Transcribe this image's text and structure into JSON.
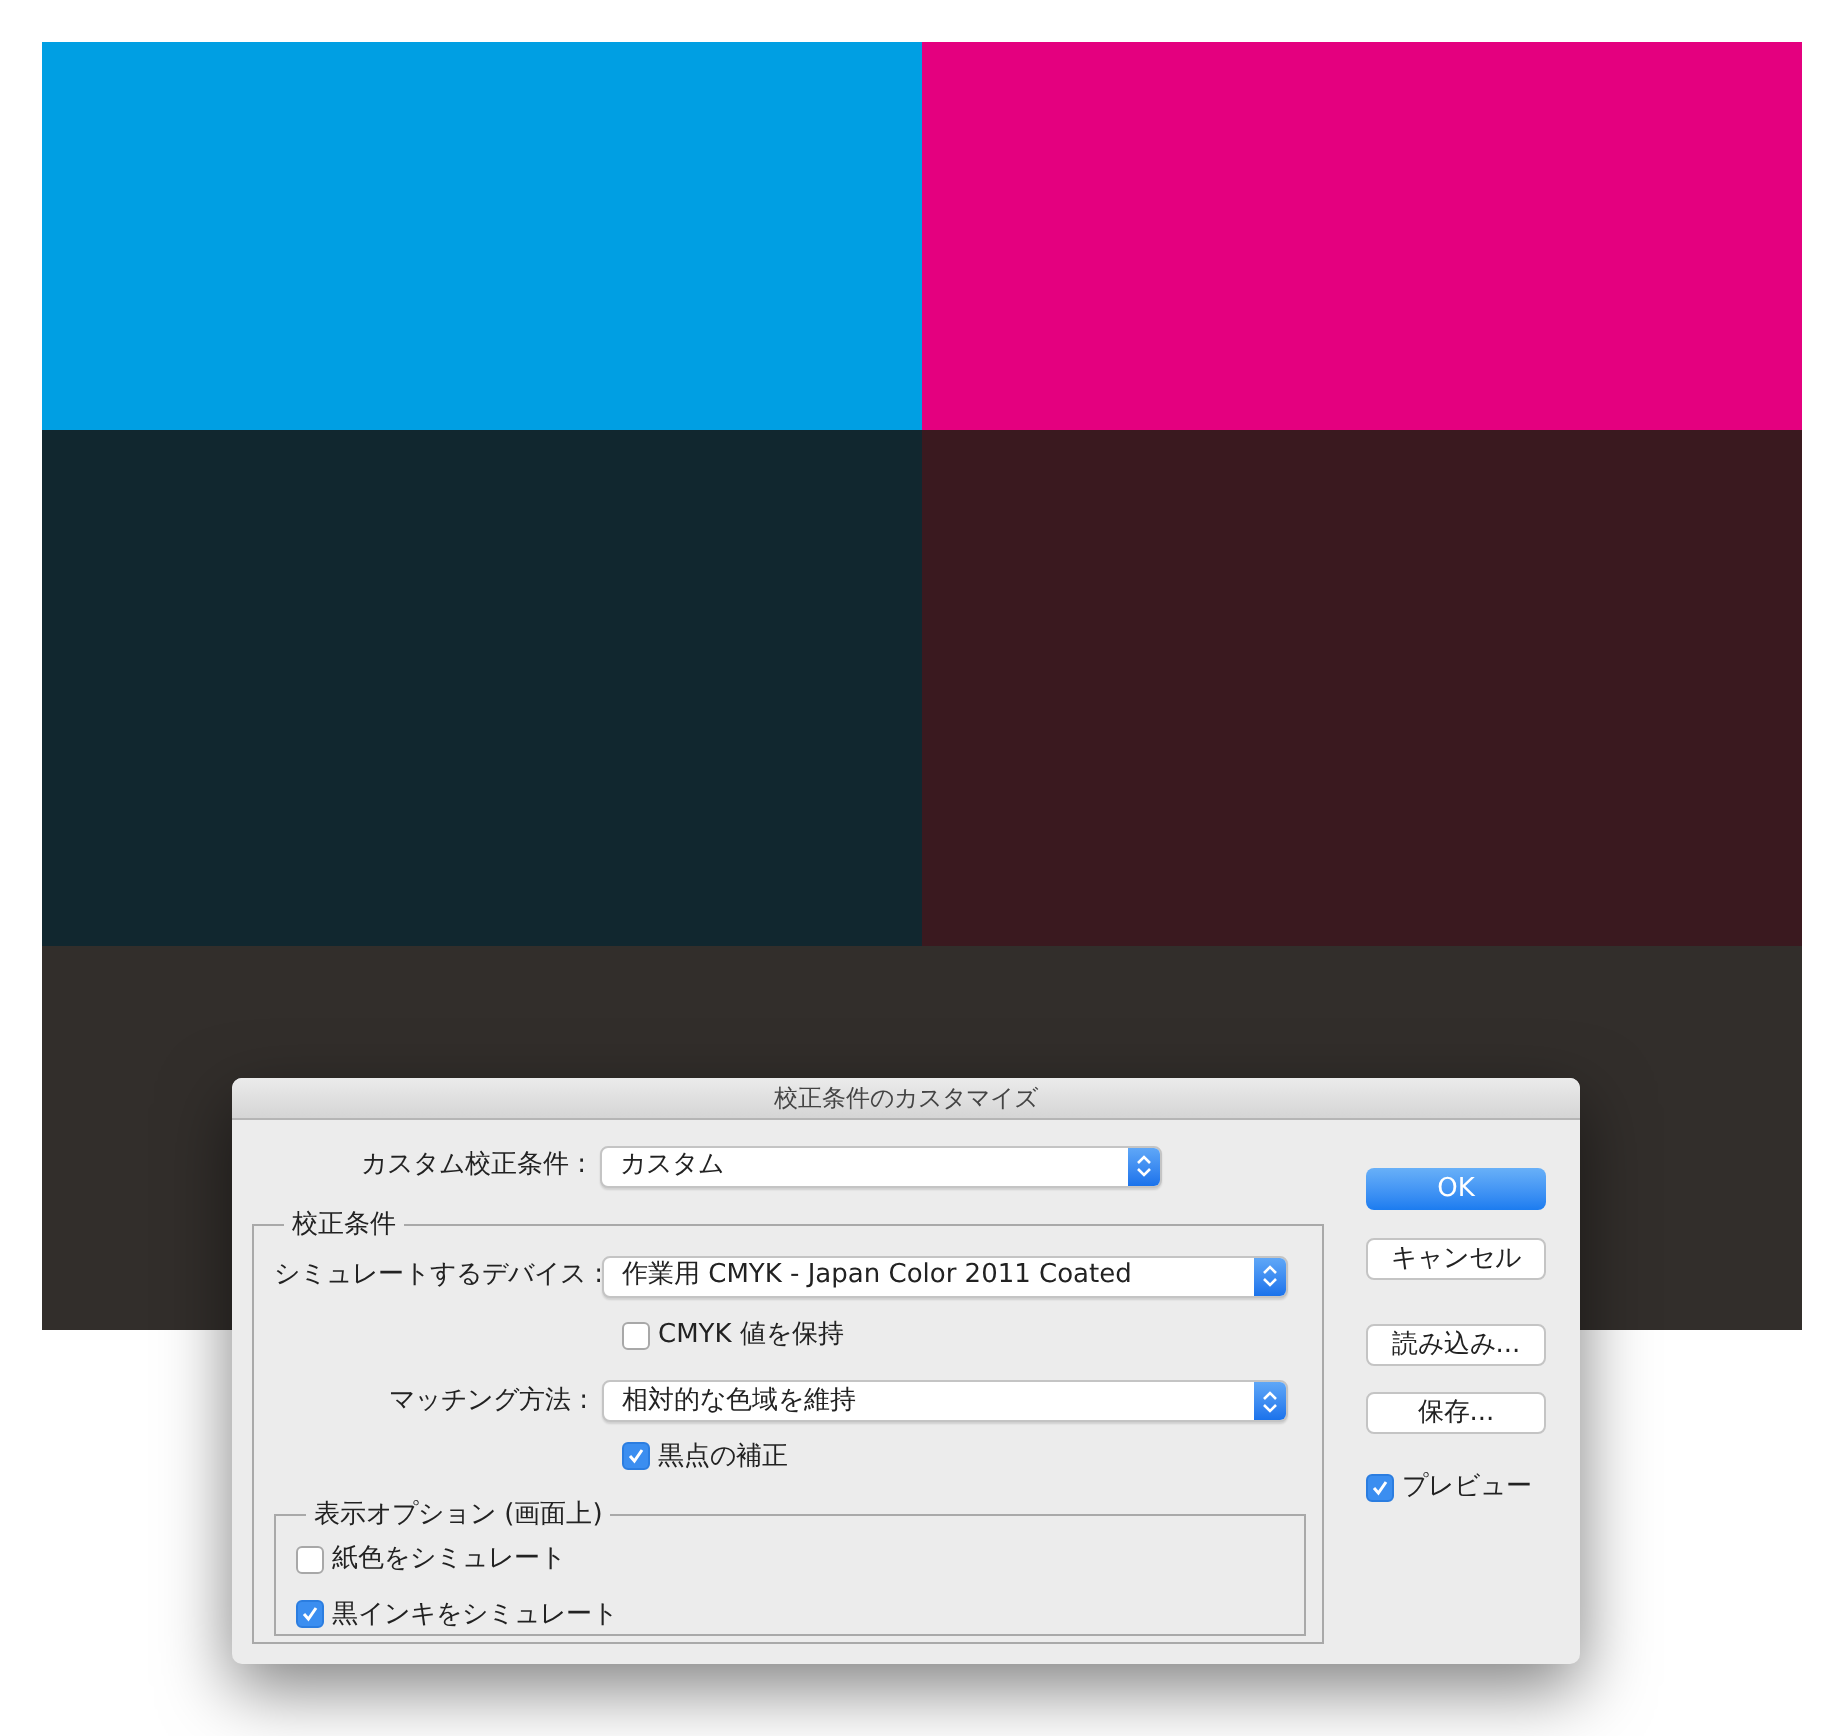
{
  "canvas": {
    "swatches": [
      {
        "color": "#009fe3"
      },
      {
        "color": "#e4007f"
      },
      {
        "color": "#11272f"
      },
      {
        "color": "#3a191f"
      },
      {
        "color": "#322e2b"
      }
    ]
  },
  "dialog": {
    "title": "校正条件のカスタマイズ",
    "preset": {
      "label": "カスタム校正条件 :",
      "value": "カスタム"
    },
    "proof_group": {
      "legend": "校正条件",
      "device": {
        "label": "シミュレートするデバイス :",
        "value": "作業用 CMYK - Japan Color 2011 Coated"
      },
      "preserve_cmyk": {
        "label": "CMYK 値を保持",
        "checked": false
      },
      "intent": {
        "label": "マッチング方法 :",
        "value": "相対的な色域を維持"
      },
      "black_point": {
        "label": "黒点の補正",
        "checked": true
      }
    },
    "display_group": {
      "legend": "表示オプション (画面上)",
      "options": [
        {
          "label": "紙色をシミュレート",
          "checked": false
        },
        {
          "label": "黒インキをシミュレート",
          "checked": true
        }
      ]
    },
    "buttons": [
      {
        "label": "OK",
        "default": true
      },
      {
        "label": "キャンセル",
        "default": false
      },
      {
        "label": "読み込み...",
        "default": false
      },
      {
        "label": "保存...",
        "default": false
      }
    ],
    "preview": {
      "label": "プレビュー",
      "checked": true
    }
  }
}
